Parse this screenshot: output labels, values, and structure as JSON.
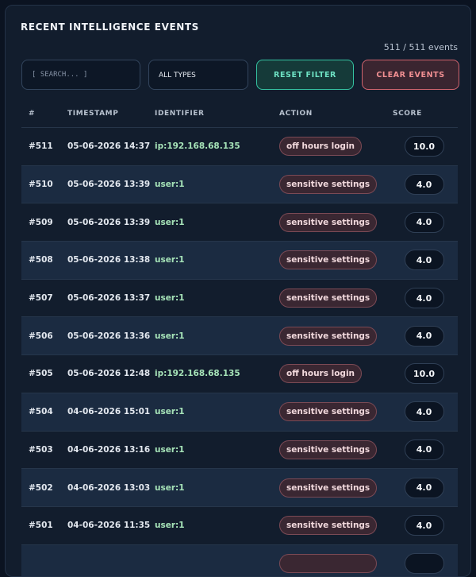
{
  "panel": {
    "title": "RECENT INTELLIGENCE EVENTS",
    "count": "511 / 511 events"
  },
  "controls": {
    "search_placeholder": "[ SEARCH... ]",
    "type_filter": "ALL TYPES",
    "reset_label": "RESET FILTER",
    "clear_label": "CLEAR EVENTS"
  },
  "table": {
    "headers": {
      "num": "#",
      "timestamp": "TIMESTAMP",
      "identifier": "IDENTIFIER",
      "action": "ACTION",
      "score": "SCORE"
    },
    "rows": [
      {
        "num": "#511",
        "timestamp": "05-06-2026 14:37",
        "identifier": "ip:192.168.68.135",
        "action": "off hours login",
        "score": "10.0"
      },
      {
        "num": "#510",
        "timestamp": "05-06-2026 13:39",
        "identifier": "user:1",
        "action": "sensitive settings",
        "score": "4.0"
      },
      {
        "num": "#509",
        "timestamp": "05-06-2026 13:39",
        "identifier": "user:1",
        "action": "sensitive settings",
        "score": "4.0"
      },
      {
        "num": "#508",
        "timestamp": "05-06-2026 13:38",
        "identifier": "user:1",
        "action": "sensitive settings",
        "score": "4.0"
      },
      {
        "num": "#507",
        "timestamp": "05-06-2026 13:37",
        "identifier": "user:1",
        "action": "sensitive settings",
        "score": "4.0"
      },
      {
        "num": "#506",
        "timestamp": "05-06-2026 13:36",
        "identifier": "user:1",
        "action": "sensitive settings",
        "score": "4.0"
      },
      {
        "num": "#505",
        "timestamp": "05-06-2026 12:48",
        "identifier": "ip:192.168.68.135",
        "action": "off hours login",
        "score": "10.0"
      },
      {
        "num": "#504",
        "timestamp": "04-06-2026 15:01",
        "identifier": "user:1",
        "action": "sensitive settings",
        "score": "4.0"
      },
      {
        "num": "#503",
        "timestamp": "04-06-2026 13:16",
        "identifier": "user:1",
        "action": "sensitive settings",
        "score": "4.0"
      },
      {
        "num": "#502",
        "timestamp": "04-06-2026 13:03",
        "identifier": "user:1",
        "action": "sensitive settings",
        "score": "4.0"
      },
      {
        "num": "#501",
        "timestamp": "04-06-2026 11:35",
        "identifier": "user:1",
        "action": "sensitive settings",
        "score": "4.0"
      }
    ]
  }
}
